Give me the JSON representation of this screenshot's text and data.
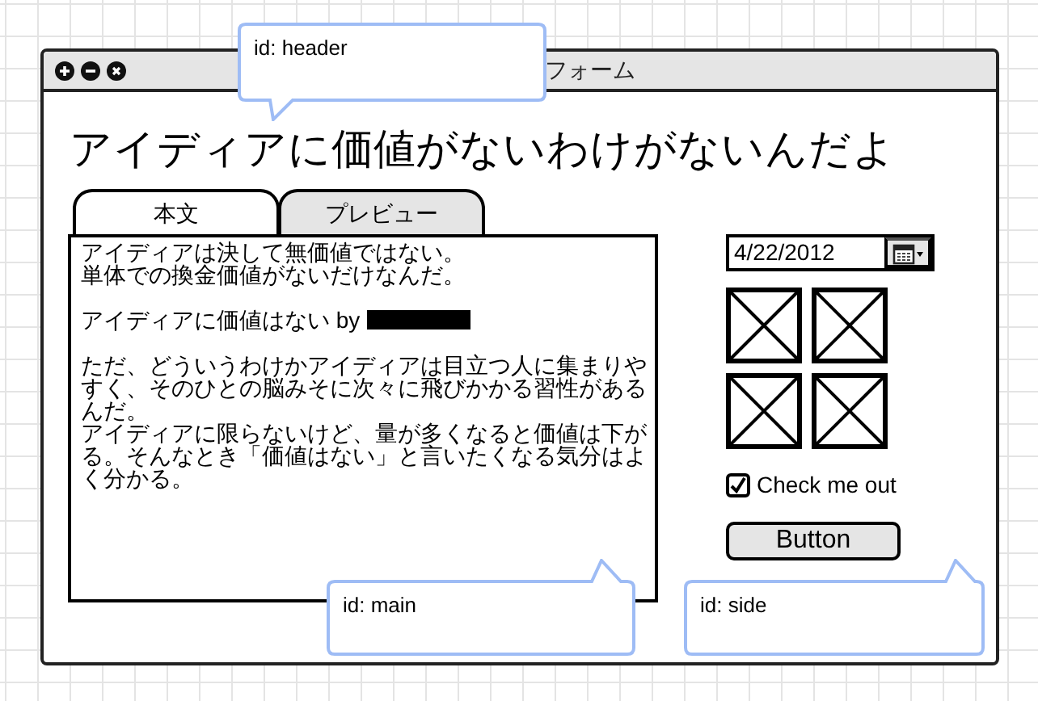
{
  "window": {
    "title": "フォーム",
    "controls": [
      {
        "kind": "maximize"
      },
      {
        "kind": "minimize"
      },
      {
        "kind": "close"
      }
    ]
  },
  "heading": "アイディアに価値がないわけがないんだよ",
  "tabs": [
    {
      "label": "本文",
      "selected": true
    },
    {
      "label": "プレビュー",
      "selected": false
    }
  ],
  "body": [
    {
      "lines": [
        "アイディアは決して無価値ではない。",
        "単体での換金価値がないだけなんだ。"
      ],
      "redacted": false
    },
    {
      "lines": [
        "アイディアに価値はない by"
      ],
      "redacted": true
    },
    {
      "lines": [
        "ただ、どういうわけかアイディアは目立つ人に集まりやすく、そのひとの脳みそに次々に飛びかかる習性があるんだ。",
        "アイディアに限らないけど、量が多くなると価値は下がる。そんなとき「価値はない」と言いたくなる気分はよく分かる。"
      ],
      "redacted": false
    }
  ],
  "side": {
    "date_field": {
      "value": "4/22/2012"
    },
    "image_placeholders": [
      {
        "kind": "placeholder"
      },
      {
        "kind": "placeholder"
      },
      {
        "kind": "placeholder"
      },
      {
        "kind": "placeholder"
      }
    ],
    "checkbox": {
      "label": "Check me out",
      "checked": true
    },
    "button": "Button"
  },
  "callouts": [
    {
      "text": "id: header",
      "kind": "tail-down"
    },
    {
      "text": "id: main",
      "kind": "tail-up"
    },
    {
      "text": "id: side",
      "kind": "tail-up"
    }
  ]
}
